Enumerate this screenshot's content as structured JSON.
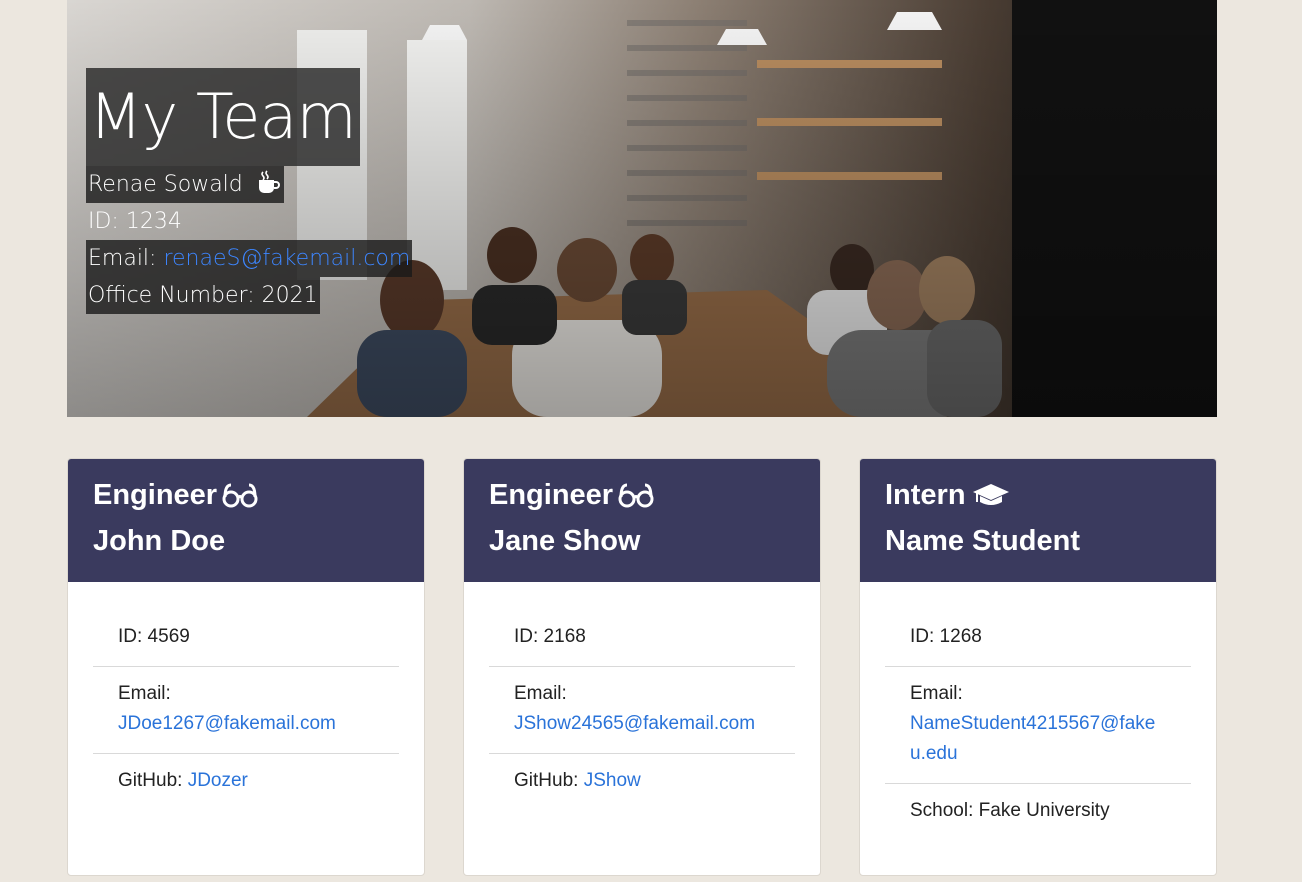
{
  "hero": {
    "title": "My Team",
    "manager_name": "Renae Sowald",
    "manager_icon": "coffee-icon",
    "id_label": "ID: 1234",
    "email_label": "Email: ",
    "email": "renaeS@fakemail.com",
    "office_label": "Office Number: 2021"
  },
  "cards": [
    {
      "role": "Engineer",
      "role_icon": "glasses-icon",
      "name": "John Doe",
      "id_text": "ID: 4569",
      "email_label": "Email:",
      "email": "JDoe1267@fakemail.com",
      "extra_label": "GitHub: ",
      "extra_value": "JDozer"
    },
    {
      "role": "Engineer",
      "role_icon": "glasses-icon",
      "name": "Jane Show",
      "id_text": "ID: 2168",
      "email_label": "Email:",
      "email": "JShow24565@fakemail.com",
      "extra_label": "GitHub: ",
      "extra_value": "JShow"
    },
    {
      "role": "Intern",
      "role_icon": "graduation-cap-icon",
      "name": "Name Student",
      "id_text": "ID: 1268",
      "email_label": "Email:",
      "email_line1": "NameStudent4215567@fake",
      "email_line2": "u.edu",
      "extra_label": "School: Fake University"
    }
  ],
  "colors": {
    "page_bg": "#ece7df",
    "card_header": "#3a3a5e",
    "link": "#2a73d9"
  }
}
